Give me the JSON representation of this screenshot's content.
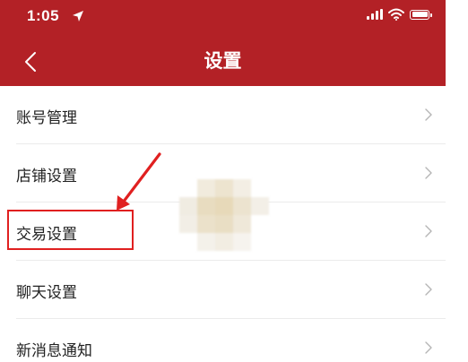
{
  "status_bar": {
    "time": "1:05"
  },
  "header": {
    "title": "设置"
  },
  "settings_items": [
    {
      "label": "账号管理"
    },
    {
      "label": "店铺设置"
    },
    {
      "label": "交易设置"
    },
    {
      "label": "聊天设置"
    },
    {
      "label": "新消息通知"
    }
  ],
  "colors": {
    "header_bg": "#b32126",
    "annotation": "#e02020",
    "divider": "#ebebeb"
  },
  "icons": [
    "location-arrow-icon",
    "signal-icon",
    "wifi-icon",
    "battery-icon",
    "back-chevron-icon",
    "chevron-right-icon"
  ]
}
